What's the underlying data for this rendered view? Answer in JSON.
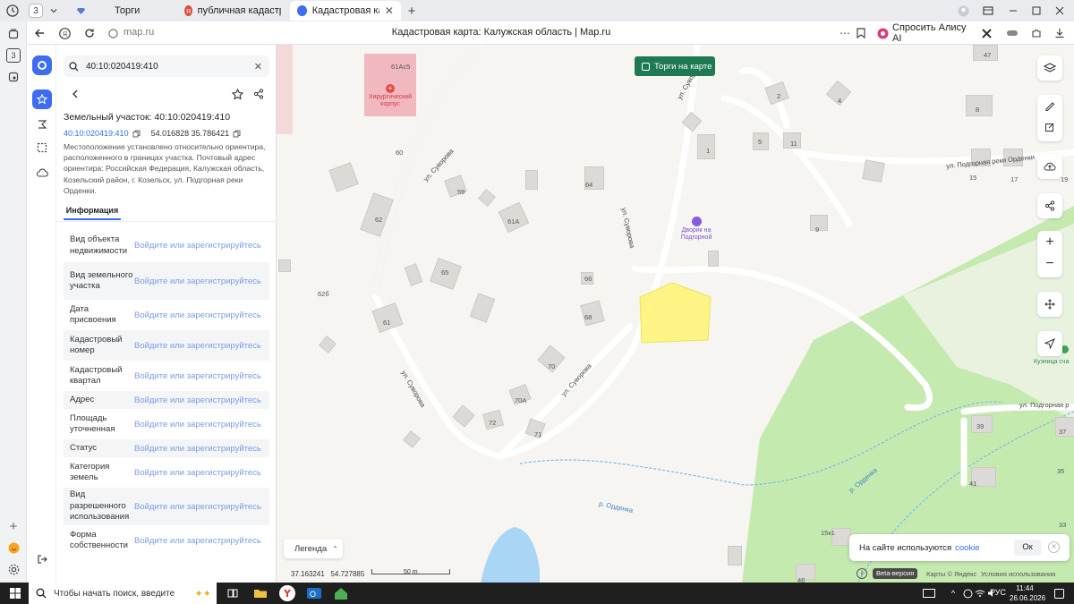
{
  "browser": {
    "tab_count": "3",
    "tabs": [
      {
        "label": "Торги"
      },
      {
        "label": "публичная кадастровая к"
      },
      {
        "label": "Кадастровая карта: Ка"
      }
    ],
    "url": "map.ru",
    "page_title": "Кадастровая карта: Калужская область | Map.ru",
    "alice_label": "Спросить Алису AI",
    "sidebar_badge": "3"
  },
  "panel": {
    "search_value": "40:10:020419:410",
    "title": "Земельный участок: 40:10:020419:410",
    "cad_number": "40:10:020419:410",
    "coords": "54.016828 35.786421",
    "description": "Местоположение установлено относительно ориентира, расположенного в границах участка. Почтовый адрес ориентира: Российская Федерация, Калужская область, Козельский район, г. Козельск, ул. Подгорная реки Орденки.",
    "tab_info": "Информация",
    "rows": [
      {
        "key": "Вид объекта недвижимости",
        "value": "Войдите или зарегистрируйтесь"
      },
      {
        "key": "Вид земельного участка",
        "value": "Войдите или зарегистрируйтесь"
      },
      {
        "key": "Дата присвоения",
        "value": "Войдите или зарегистрируйтесь"
      },
      {
        "key": "Кадастровый номер",
        "value": "Войдите или зарегистрируйтесь"
      },
      {
        "key": "Кадастровый квартал",
        "value": "Войдите или зарегистрируйтесь"
      },
      {
        "key": "Адрес",
        "value": "Войдите или зарегистрируйтесь"
      },
      {
        "key": "Площадь уточненная",
        "value": "Войдите или зарегистрируйтесь"
      },
      {
        "key": "Статус",
        "value": "Войдите или зарегистрируйтесь"
      },
      {
        "key": "Категория земель",
        "value": "Войдите или зарегистрируйтесь"
      },
      {
        "key": "Вид разрешенного использования",
        "value": "Войдите или зарегистрируйтесь"
      },
      {
        "key": "Форма собственности",
        "value": "Войдите или зарегистрируйтесь"
      }
    ]
  },
  "map": {
    "torgi_button": "Торги на карте",
    "legend": "Легенда",
    "coords_readout": "37.163241   54.727885",
    "scale": "50 m",
    "beta": "Beta-версия",
    "attribution": "Карты © Яндекс",
    "terms": "Условия использования",
    "cookie_text": "На сайте используются",
    "cookie_link": "cookie",
    "cookie_ok": "Ок",
    "poi_hospital": "Хирургический корпус",
    "poi_dvorik": "Дворик на Подгорной",
    "poi_kuznitsa": "Кузница сча",
    "streets": {
      "suvorova1": "ул. Суворова",
      "suvorova2": "ул. Суворова",
      "suvorova3": "ул. Суворова",
      "suvorova4": "ул. Суворова",
      "podgornaya1": "ул. Подгорная реки Орденки",
      "podgornaya2": "ул. Подгорная р",
      "ordenka1": "р. Орденка",
      "ordenka2": "р. Орденка"
    },
    "houses": {
      "h61ac5": "61Ас5",
      "h60": "60",
      "h59": "59",
      "h61a": "61А",
      "h62": "62",
      "h65": "65",
      "h626": "62б",
      "h61": "61",
      "h66": "66",
      "h68": "68",
      "h70": "70",
      "h70a": "70А",
      "h72": "72",
      "h71": "71",
      "h64": "64",
      "h2": "2",
      "h4": "4",
      "h8": "8",
      "h5": "5",
      "h11": "11",
      "h1": "1",
      "h15": "15",
      "h17": "17",
      "h19": "19",
      "h9": "9",
      "h47": "47",
      "h39": "39",
      "h37": "37",
      "h35": "35",
      "h41": "41",
      "h33": "33",
      "h15x1": "15к1",
      "h46": "46"
    }
  },
  "taskbar": {
    "search_placeholder": "Чтобы начать поиск, введите",
    "lang": "РУС",
    "time": "11:44",
    "date": "26.06.2026"
  },
  "colors": {
    "accent": "#3d6df2",
    "green_button": "#1f7a54",
    "parcel_fill": "#fff47a",
    "forest": "#c5eab0",
    "water": "#a9d6f5"
  }
}
